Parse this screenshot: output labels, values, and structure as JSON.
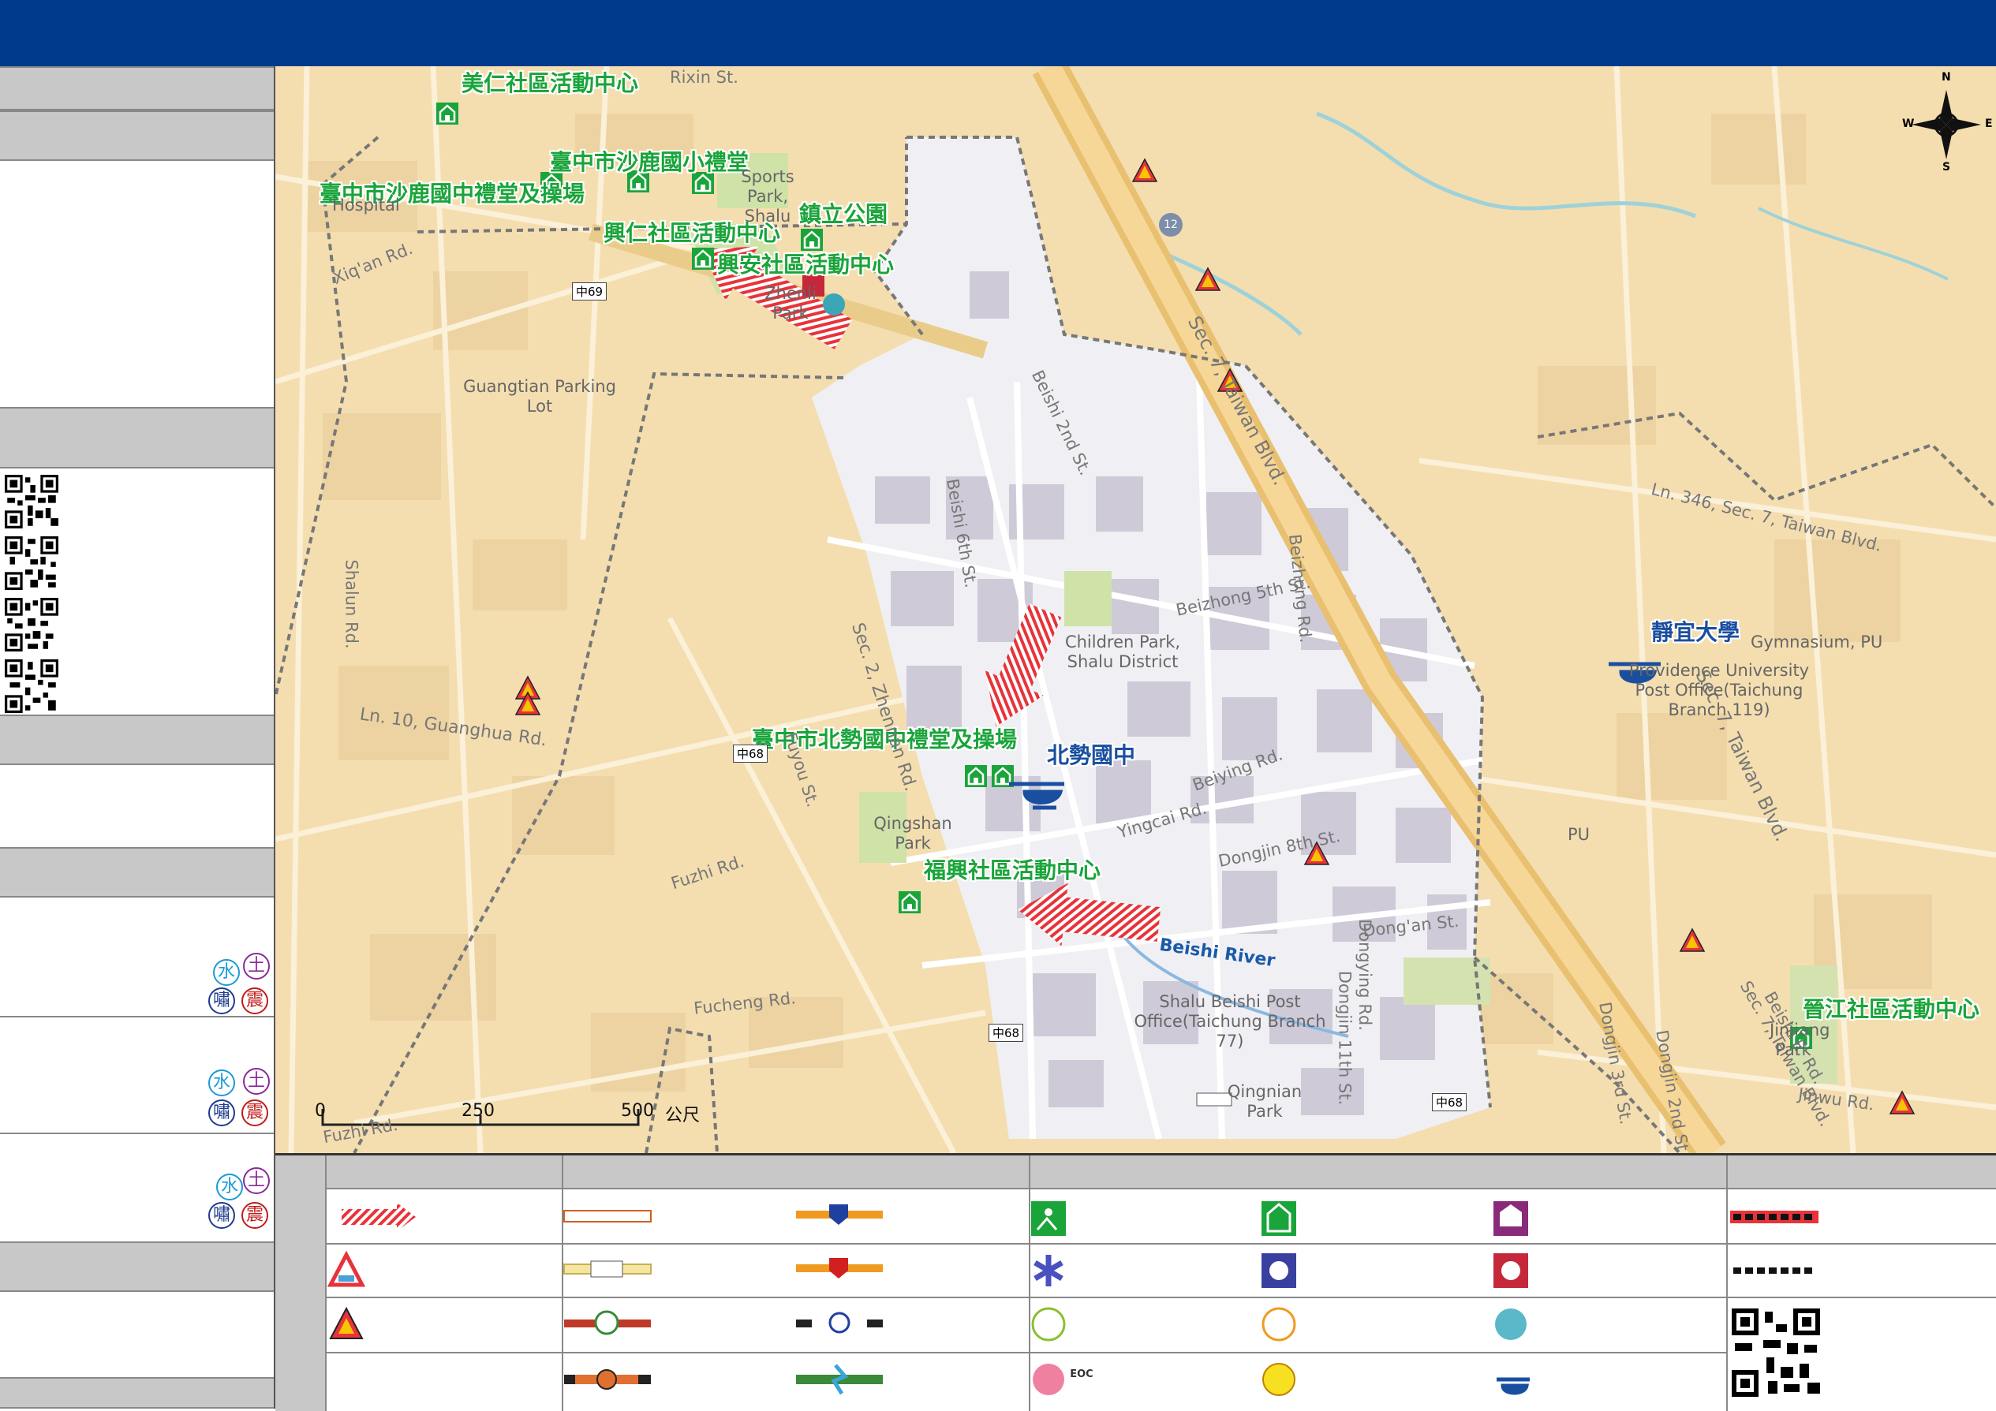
{
  "map": {
    "facility_labels": [
      {
        "id": "meiren",
        "text": "美仁社區活動中心"
      },
      {
        "id": "shalu-elem",
        "text": "臺中市沙鹿國小禮堂"
      },
      {
        "id": "shalu-jh",
        "text": "臺中市沙鹿國中禮堂及操場"
      },
      {
        "id": "zhenli-park",
        "text": "鎮立公園"
      },
      {
        "id": "xingren",
        "text": "興仁社區活動中心"
      },
      {
        "id": "xingan",
        "text": "興安社區活動中心"
      },
      {
        "id": "beishi-jh-hall",
        "text": "臺中市北勢國中禮堂及操場"
      },
      {
        "id": "beishi-jh",
        "text": "北勢國中"
      },
      {
        "id": "fuxing",
        "text": "福興社區活動中心"
      },
      {
        "id": "providence",
        "text": "靜宜大學"
      },
      {
        "id": "jinjiang",
        "text": "晉江社區活動中心"
      }
    ],
    "road_labels": [
      {
        "id": "rixin",
        "text": "Rixin St."
      },
      {
        "id": "xiqian",
        "text": "Xiq'an Rd."
      },
      {
        "id": "zhongsan",
        "text": "Sec. 7, Taiwan Blvd."
      },
      {
        "id": "beishi2",
        "text": "Beishi 2nd St."
      },
      {
        "id": "beishi6",
        "text": "Beishi 6th St."
      },
      {
        "id": "zhenan",
        "text": "Sec. 2, Zhennan Rd."
      },
      {
        "id": "beizhong",
        "text": "Beizhong 5th St."
      },
      {
        "id": "beiying",
        "text": "Beiying Rd."
      },
      {
        "id": "yingcai",
        "text": "Yingcai Rd."
      },
      {
        "id": "dongjin",
        "text": "Dongjin 8th St."
      },
      {
        "id": "dongan",
        "text": "Dong'an St."
      },
      {
        "id": "guanghua",
        "text": "Ln. 10, Guanghua Rd."
      },
      {
        "id": "fuzhi",
        "text": "Fuzhi Rd."
      },
      {
        "id": "fucheng",
        "text": "Fucheng Rd."
      },
      {
        "id": "fuzhi2",
        "text": "Fuzhi Rd."
      },
      {
        "id": "jinwu",
        "text": "Jinwu Rd."
      },
      {
        "id": "ln346",
        "text": "Ln. 346, Sec. 7, Taiwan Blvd."
      },
      {
        "id": "sec7b",
        "text": "Sec. 7, Taiwan Blvd."
      },
      {
        "id": "sec7c",
        "text": "Sec. 7, Taiwan Blvd."
      },
      {
        "id": "shalun",
        "text": "Shalun Rd."
      },
      {
        "id": "dongying",
        "text": "Dongying Rd."
      },
      {
        "id": "dongjin11",
        "text": "Dongjin 11th St."
      },
      {
        "id": "dongjin3",
        "text": "Dongjin 3rd St."
      },
      {
        "id": "dongjin2",
        "text": "Dongjin 2nd St."
      },
      {
        "id": "beishi-e",
        "text": "Beishi E. Rd."
      },
      {
        "id": "beizhong-rd",
        "text": "Beizhong Rd."
      },
      {
        "id": "fuyou",
        "text": "Fuyou St."
      },
      {
        "id": "beishi-river",
        "text": "Beishi River"
      }
    ],
    "place_labels": [
      {
        "id": "sports-park",
        "text": "Sports Park, Shalu"
      },
      {
        "id": "zhenli",
        "text": "Zhenli Park"
      },
      {
        "id": "guangtian",
        "text": "Guangtian Parking Lot"
      },
      {
        "id": "children-park",
        "text": "Children Park, Shalu District"
      },
      {
        "id": "qingshan",
        "text": "Qingshan Park"
      },
      {
        "id": "post-beishi",
        "text": "Shalu Beishi Post Office(Taichung Branch 77)"
      },
      {
        "id": "qingnian",
        "text": "Qingnian Park"
      },
      {
        "id": "post-pu",
        "text": "Providence University Post Office(Taichung Branch 119)"
      },
      {
        "id": "gym-pu",
        "text": "Gymnasium, PU"
      },
      {
        "id": "pu",
        "text": "PU"
      },
      {
        "id": "hospital",
        "text": "Hospital"
      },
      {
        "id": "jinjiang-park",
        "text": "Jinjiang Park"
      }
    ],
    "shields": [
      "12",
      "中69",
      "中68",
      "中68",
      "中68"
    ],
    "scale": {
      "ticks": [
        "0",
        "250",
        "500"
      ],
      "unit": "公尺"
    },
    "compass": {
      "n": "N",
      "s": "S",
      "e": "E",
      "w": "W"
    }
  },
  "sidebar": {
    "hazard_glyphs": {
      "water": "水",
      "soil": "土",
      "tsunami": "嘯",
      "quake": "震"
    }
  },
  "legend": {
    "badges": {
      "eoc": "EOC"
    }
  },
  "colors": {
    "header": "#003a8c",
    "facility_text": "#1aa43a",
    "district": "#f0f0f4",
    "base": "#f4deb0",
    "evac_arrow": "#e8333a",
    "highway": "#f2c879"
  }
}
